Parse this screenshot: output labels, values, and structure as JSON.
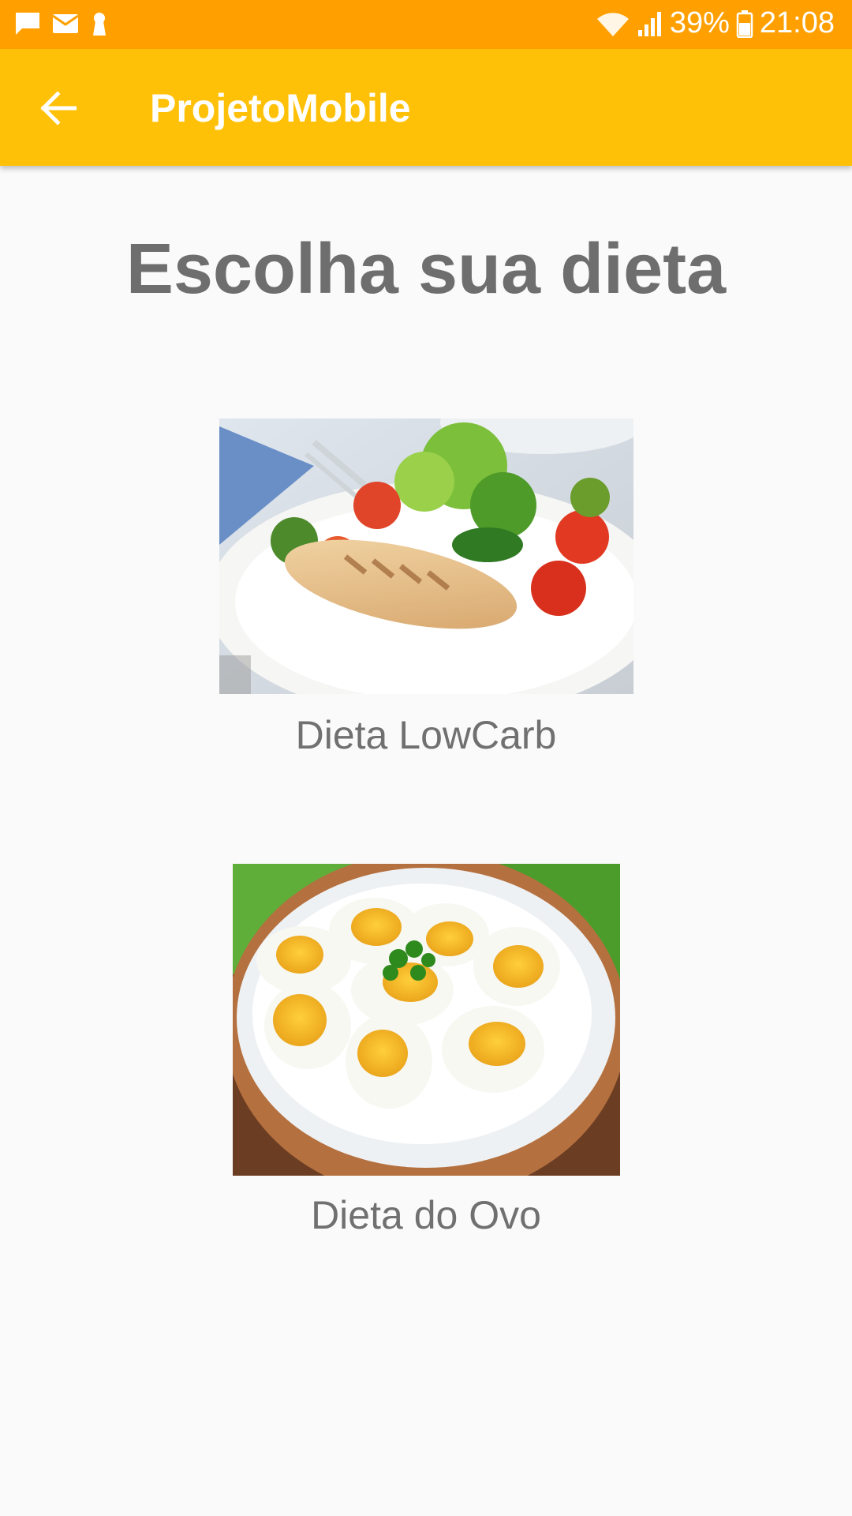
{
  "status_bar": {
    "battery": "39%",
    "time": "21:08",
    "icons": [
      "message-icon",
      "mail-icon",
      "keyhole-icon",
      "wifi-icon",
      "signal-icon",
      "battery-icon"
    ]
  },
  "app_bar": {
    "title": "ProjetoMobile",
    "back_icon": "arrow-back-icon"
  },
  "page": {
    "title": "Escolha sua dieta"
  },
  "diets": [
    {
      "label": "Dieta LowCarb",
      "image": "grilled-chicken-salad-image"
    },
    {
      "label": "Dieta do Ovo",
      "image": "boiled-eggs-plate-image"
    }
  ],
  "colors": {
    "status_bar": "#ffa000",
    "app_bar": "#ffc107",
    "background": "#fafafa",
    "text": "#6e6e6e"
  }
}
